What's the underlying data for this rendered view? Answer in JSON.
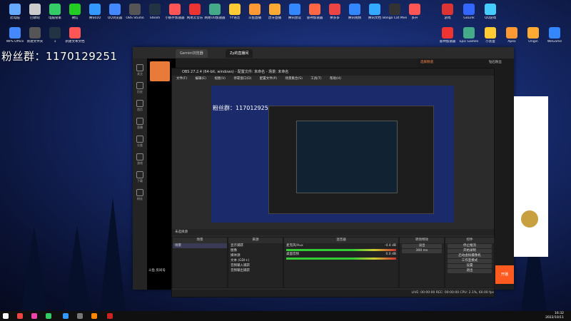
{
  "fans_group": "粉丝群：1170129251",
  "desktop_icons_top": [
    "此电脑",
    "回收站",
    "电脑管家",
    "微信",
    "腾讯QQ",
    "QQ浏览器",
    "OBS Studio",
    "Steam",
    "小鹅手加速器",
    "网易云音乐",
    "网易UU加速器",
    "YY语音",
    "斗鱼直播",
    "虎牙直播",
    "腾讯会议",
    "雷神加速器",
    "拼多多",
    "腾讯视频",
    "腾讯文档",
    "Bongo Cat Mver",
    "多开",
    "游戏",
    "GoLink",
    "QQ游戏"
  ],
  "desktop_icons_second": [
    "WPS Office",
    "新建文件夹",
    "1",
    "新建文本文档",
    "雷神加速器",
    "Epic Games",
    "小黑盒",
    "Apex",
    "Origin",
    "WeGame"
  ],
  "browser": {
    "tabs": [
      "Gemini浏览器",
      "Zy的直播间"
    ],
    "sidebar": [
      "关注",
      "历史",
      "首页",
      "直播",
      "分类",
      "游戏",
      "下载",
      "粉丝"
    ],
    "right_tabs": [
      "选择频道",
      "钻石粉丝"
    ],
    "go_live": "开播",
    "viewer_label": "斗鱼 房间号"
  },
  "obs": {
    "title": "OBS 27.2.4 (64-bit, windows) - 配置文件: 未命名 - 场景: 未命名",
    "menu": [
      "文件(F)",
      "编辑(E)",
      "视图(V)",
      "停靠窗口(D)",
      "配置文件(P)",
      "场景集合(S)",
      "工具(T)",
      "帮助(H)"
    ],
    "preview_fans": "粉丝群：1170129251",
    "no_source": "未选择源",
    "docks": {
      "scenes": {
        "title": "场景",
        "items": [
          "场景"
        ]
      },
      "sources": {
        "title": "来源",
        "items": [
          "显示捕获",
          "图像",
          "媒体源",
          "文本 (GDI+)",
          "音频输入捕获",
          "音频输出捕获"
        ]
      },
      "mixer": {
        "title": "混音器",
        "channels": [
          {
            "name": "麦克风/Aux",
            "db": "-4.4 dB"
          },
          {
            "name": "桌面音频",
            "db": "0.0 dB"
          }
        ]
      },
      "transitions": {
        "title": "转场特效",
        "mode": "淡出",
        "duration": "300 ms"
      },
      "controls": {
        "title": "控件",
        "buttons": [
          "停止推流",
          "开始录制",
          "启动虚拟摄像机",
          "工作室模式",
          "设置",
          "退出"
        ]
      }
    },
    "status": "LIVE: 00:00:00   REC: 00:00:00   CPU: 2.1%, 60.00 fps"
  },
  "taskbar": {
    "time": "16:32",
    "date": "2022/10/11"
  }
}
